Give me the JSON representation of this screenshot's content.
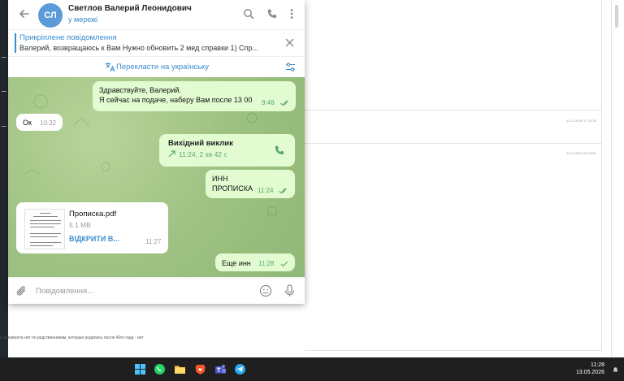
{
  "chat_header": {
    "avatar_initials": "СЛ",
    "contact_name": "Светлов Валерий Леонидович",
    "status": "у мережі"
  },
  "pinned": {
    "title": "Прикріплене повідомлення",
    "text": "Валерий, возвращаюсь к Вам  Нужно обновить 2 мед справки 1) Спр..."
  },
  "translate": {
    "label": "Перекласти на українську"
  },
  "messages": [
    {
      "direction": "out",
      "lines": [
        "Здравствуйте, Валерий.",
        "Я сейчас на подаче, наберу Вам после 13 00"
      ],
      "time": "9:46",
      "status": "read"
    },
    {
      "direction": "in",
      "lines": [
        "Ок"
      ],
      "time": "10:32"
    },
    {
      "direction": "out",
      "type": "call",
      "title": "Вихідний виклик",
      "detail": "11:24, 2 хв 42 с"
    },
    {
      "direction": "out",
      "lines": [
        "ИНН",
        "ПРОПИСКА"
      ],
      "time": "11:24",
      "status": "read"
    },
    {
      "direction": "in",
      "type": "file",
      "file_name": "Прописка.pdf",
      "file_size": "5.1 MB",
      "action": "ВІДКРИТИ В...",
      "time": "11:27"
    },
    {
      "direction": "out",
      "lines": [
        "Еще инн"
      ],
      "time": "11:28",
      "status": "sent"
    }
  ],
  "composer": {
    "placeholder": "Повідомлення..."
  },
  "background": {
    "stamp_1": "01.12.2025 17:19:26",
    "stamp_2": "20.11.2025 10:08:26",
    "footer_text": "о документа нет по родственникам, которые родились после 40го года - нет"
  },
  "taskbar": {
    "apps": [
      "windows-start-icon",
      "whatsapp-icon",
      "file-explorer-icon",
      "brave-browser-icon",
      "teams-icon",
      "telegram-icon"
    ],
    "time": "11:28",
    "date": "13.05.2026"
  },
  "colors": {
    "accent": "#3a8bd0",
    "outgoing_bubble": "#e2fbd1",
    "chat_bg": "#9fc283",
    "taskbar": "#1f1f1f"
  }
}
